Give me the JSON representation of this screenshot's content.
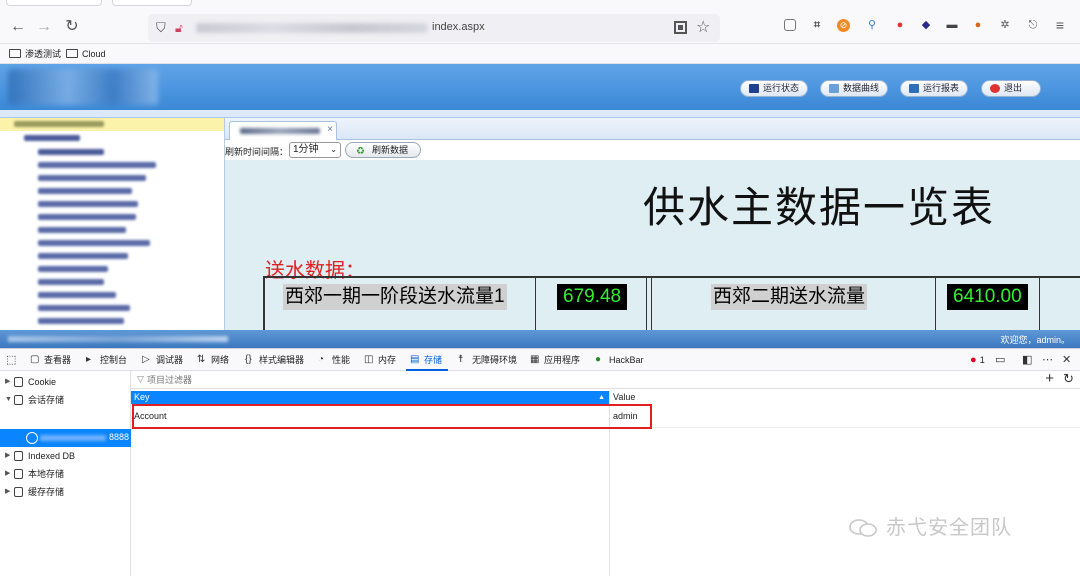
{
  "browser": {
    "url_path": "index.aspx",
    "bookmarks": [
      {
        "label": "渗透测试"
      },
      {
        "label": "Cloud"
      }
    ]
  },
  "app": {
    "header_buttons": [
      {
        "label": "运行状态",
        "icon": "monitor-icon",
        "color": "#1f3f8f"
      },
      {
        "label": "数据曲线",
        "icon": "chart-icon",
        "color": "#6a9fd8"
      },
      {
        "label": "运行报表",
        "icon": "report-icon",
        "color": "#2f6fb8"
      },
      {
        "label": "退出",
        "icon": "exit-icon",
        "color": "#e03030"
      }
    ],
    "refresh_label": "刷新时间间隔：",
    "refresh_interval": "1分钟",
    "refresh_button": "刷新数据",
    "dashboard_title": "供水主数据一览表",
    "section_label": "送水数据：",
    "rows": [
      {
        "name": "西郊一期一阶段送水流量1",
        "value": "679.48",
        "name2": "西郊二期送水流量",
        "value2": "6410.00"
      }
    ],
    "welcome": "欢迎您，admin。"
  },
  "devtools": {
    "tabs": [
      {
        "label": "查看器",
        "icon": "inspector-icon"
      },
      {
        "label": "控制台",
        "icon": "console-icon"
      },
      {
        "label": "调试器",
        "icon": "debugger-icon"
      },
      {
        "label": "网络",
        "icon": "network-icon"
      },
      {
        "label": "样式编辑器",
        "icon": "style-editor-icon"
      },
      {
        "label": "性能",
        "icon": "performance-icon"
      },
      {
        "label": "内存",
        "icon": "memory-icon"
      },
      {
        "label": "存储",
        "icon": "storage-icon",
        "active": true
      },
      {
        "label": "无障碍环境",
        "icon": "accessibility-icon"
      },
      {
        "label": "应用程序",
        "icon": "application-icon"
      },
      {
        "label": "HackBar",
        "icon": "hackbar-icon"
      }
    ],
    "error_count": "1",
    "sidebar": [
      {
        "label": "Cookie",
        "expanded": false
      },
      {
        "label": "会话存储",
        "expanded": true
      },
      {
        "label": "Indexed DB",
        "expanded": false
      },
      {
        "label": "本地存储",
        "expanded": false
      },
      {
        "label": "缓存存储",
        "expanded": false
      }
    ],
    "session_port": "8888",
    "filter_placeholder": "项目过滤器",
    "columns": [
      "Key",
      "Value"
    ],
    "entries": [
      {
        "key": "Account",
        "value": "admin"
      }
    ]
  },
  "watermark": "赤弋安全团队"
}
